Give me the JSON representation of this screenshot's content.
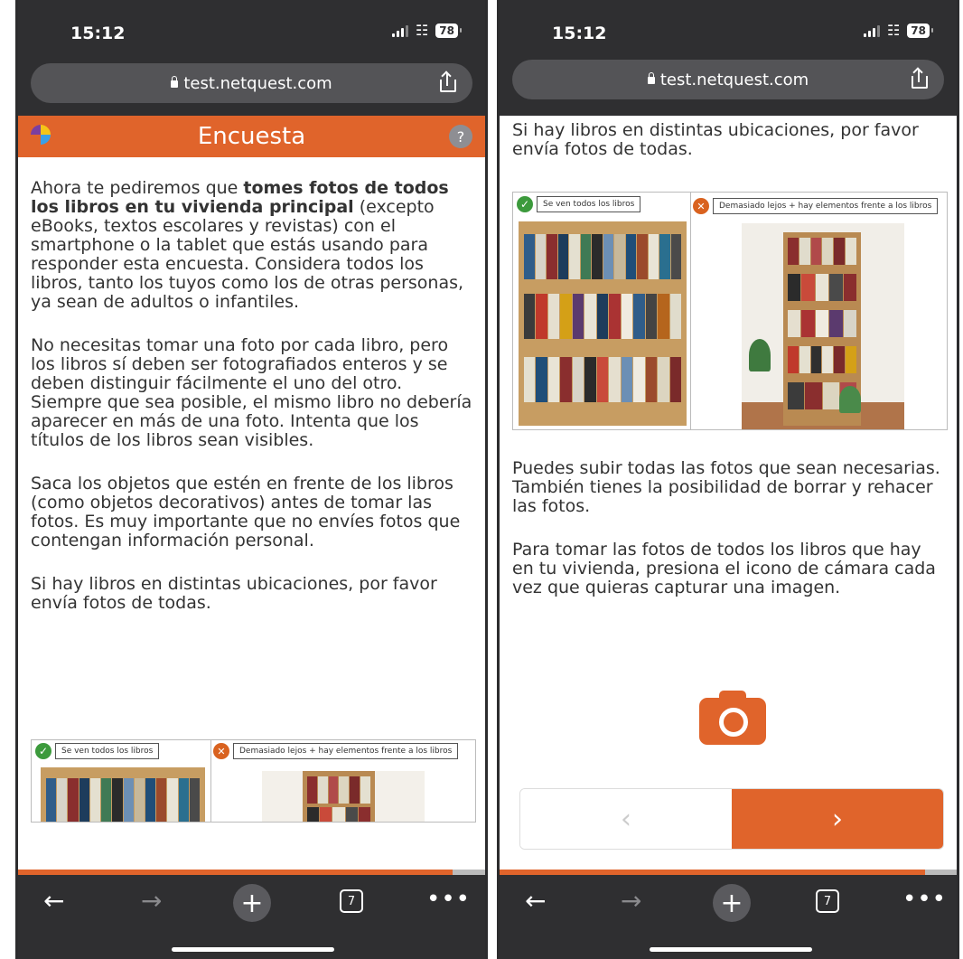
{
  "left": {
    "status": {
      "time": "15:12",
      "battery": "78"
    },
    "url": "test.netquest.com",
    "header": {
      "title": "Encuesta",
      "help": "?"
    },
    "p1": {
      "a": "Ahora te pediremos que ",
      "bold": "tomes fotos de todos los libros en tu vivienda principal",
      "b": " (excepto eBooks, textos escolares y revistas) con el smartphone o la tablet que estás usando para responder esta encuesta. Considera todos los libros, tanto los tuyos como los de otras personas, ya sean de adultos o infantiles."
    },
    "p2": "No necesitas tomar una foto por cada libro, pero los libros sí deben ser fotografiados enteros y se deben distinguir fácilmente el uno del otro. Siempre que sea posible, el mismo libro no debería aparecer en más de una foto. Intenta que los títulos de los libros sean visibles.",
    "p3": "Saca los objetos que estén en frente de los libros (como objetos decorativos) antes de tomar las fotos. Es muy importante que no envíes fotos que contengan información personal.",
    "p4": "Si hay libros en distintas ubicaciones, por favor envía fotos de todas.",
    "figure": {
      "good_label": "Se ven todos los libros",
      "bad_label": "Demasiado lejos + hay elementos frente a los libros"
    },
    "toolbar": {
      "tabs": "7",
      "more": "•••"
    },
    "progress": 0.93
  },
  "right": {
    "status": {
      "time": "15:12",
      "battery": "78"
    },
    "url": "test.netquest.com",
    "p1": "Si hay libros en distintas ubicaciones, por favor envía fotos de todas.",
    "figure": {
      "good_label": "Se ven todos los libros",
      "bad_label": "Demasiado lejos + hay elementos frente a los libros"
    },
    "p2": "Puedes subir todas las fotos que sean necesarias. También tienes la posibilidad de borrar y rehacer las fotos.",
    "p3": "Para tomar las fotos de todos los libros que hay en tu vivienda, presiona el icono de cámara cada vez que quieras capturar una imagen.",
    "nav": {
      "prev": "‹",
      "next": "›"
    },
    "toolbar": {
      "tabs": "7",
      "more": "•••"
    },
    "progress": 0.93
  },
  "colors": {
    "accent": "#e0642b",
    "chrome": "#2f2f31",
    "ok": "#3c9a3c"
  },
  "icons": [
    "lock-icon",
    "share-icon",
    "back-arrow-icon",
    "forward-arrow-icon",
    "plus-icon",
    "tabs-icon",
    "more-icon",
    "camera-icon",
    "check-icon",
    "cross-icon"
  ]
}
